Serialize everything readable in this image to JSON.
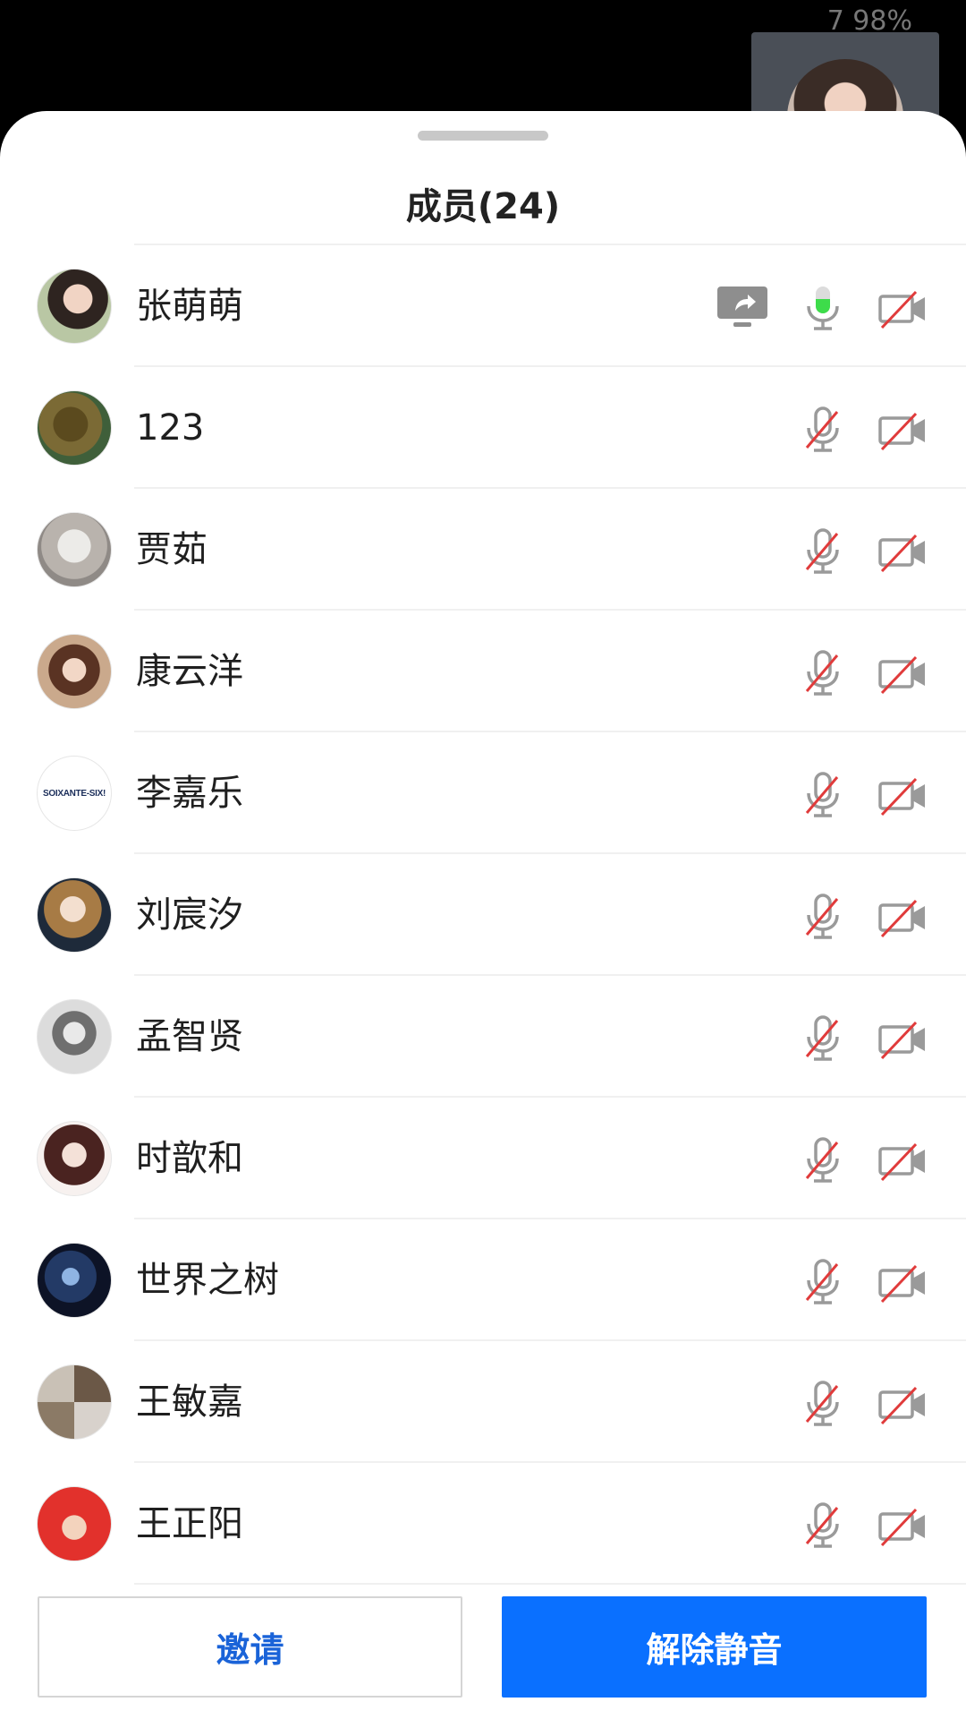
{
  "status_bar": {
    "text": "7 98%"
  },
  "sheet": {
    "title": "成员(24)"
  },
  "members": [
    {
      "name": "张萌萌",
      "sharing_screen": true,
      "mic": "active",
      "camera": "off"
    },
    {
      "name": "123",
      "sharing_screen": false,
      "mic": "muted",
      "camera": "off"
    },
    {
      "name": "贾茹",
      "sharing_screen": false,
      "mic": "muted",
      "camera": "off"
    },
    {
      "name": "康云洋",
      "sharing_screen": false,
      "mic": "muted",
      "camera": "off"
    },
    {
      "name": "李嘉乐",
      "avatar_text": "SOIXANTE-SIX!",
      "sharing_screen": false,
      "mic": "muted",
      "camera": "off"
    },
    {
      "name": "刘宸汐",
      "sharing_screen": false,
      "mic": "muted",
      "camera": "off"
    },
    {
      "name": "孟智贤",
      "sharing_screen": false,
      "mic": "muted",
      "camera": "off"
    },
    {
      "name": "时歆和",
      "sharing_screen": false,
      "mic": "muted",
      "camera": "off"
    },
    {
      "name": "世界之树",
      "sharing_screen": false,
      "mic": "muted",
      "camera": "off"
    },
    {
      "name": "王敏嘉",
      "sharing_screen": false,
      "mic": "muted",
      "camera": "off"
    },
    {
      "name": "王正阳",
      "sharing_screen": false,
      "mic": "muted",
      "camera": "off"
    }
  ],
  "footer": {
    "invite_label": "邀请",
    "unmute_label": "解除静音"
  },
  "icons": {
    "screen_share": "screen-share-icon",
    "mic_active": "microphone-active-icon",
    "mic_muted": "microphone-muted-icon",
    "camera_off": "camera-off-icon"
  },
  "colors": {
    "primary": "#0a70ff",
    "invite_text": "#1a63d8",
    "mic_active": "#3ddc4a",
    "mute_slash": "#e03b3b",
    "icon_gray": "#9a9a9a"
  }
}
